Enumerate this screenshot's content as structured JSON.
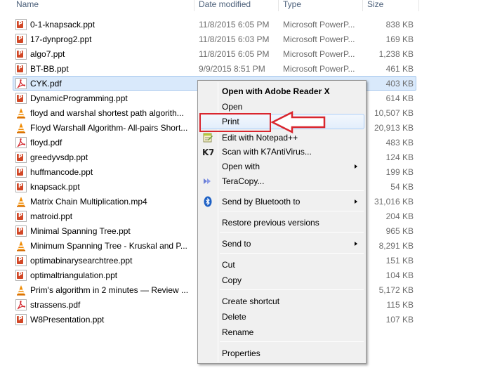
{
  "columns": {
    "name": "Name",
    "date_modified": "Date modified",
    "type": "Type",
    "size": "Size"
  },
  "files": [
    {
      "name": "0-1-knapsack.ppt",
      "date": "11/8/2015 6:05 PM",
      "type": "Microsoft PowerP...",
      "size": "838 KB",
      "icon": "ppt-icon"
    },
    {
      "name": "17-dynprog2.ppt",
      "date": "11/8/2015 6:03 PM",
      "type": "Microsoft PowerP...",
      "size": "169 KB",
      "icon": "ppt-icon"
    },
    {
      "name": "algo7.ppt",
      "date": "11/8/2015 6:05 PM",
      "type": "Microsoft PowerP...",
      "size": "1,238 KB",
      "icon": "ppt-icon"
    },
    {
      "name": "BT-BB.ppt",
      "date": "9/9/2015 8:51 PM",
      "type": "Microsoft PowerP...",
      "size": "461 KB",
      "icon": "ppt-icon"
    },
    {
      "name": "CYK.pdf",
      "date": "",
      "type": "",
      "size": "403 KB",
      "icon": "pdf-icon",
      "selected": true
    },
    {
      "name": "DynamicProgramming.ppt",
      "date": "",
      "type": "",
      "size": "614 KB",
      "icon": "ppt-icon"
    },
    {
      "name": "floyd and warshal shortest path algorith...",
      "date": "",
      "type": "",
      "size": "10,507 KB",
      "icon": "vlc-icon"
    },
    {
      "name": "Floyd Warshall Algorithm- All-pairs Short...",
      "date": "",
      "type": "",
      "size": "20,913 KB",
      "icon": "vlc-icon"
    },
    {
      "name": "floyd.pdf",
      "date": "",
      "type": "",
      "size": "483 KB",
      "icon": "pdf-icon"
    },
    {
      "name": "greedyvsdp.ppt",
      "date": "",
      "type": "",
      "size": "124 KB",
      "icon": "ppt-icon"
    },
    {
      "name": "huffmancode.ppt",
      "date": "",
      "type": "",
      "size": "199 KB",
      "icon": "ppt-icon"
    },
    {
      "name": "knapsack.ppt",
      "date": "",
      "type": "",
      "size": "54 KB",
      "icon": "ppt-icon"
    },
    {
      "name": "Matrix Chain Multiplication.mp4",
      "date": "",
      "type": "",
      "size": "31,016 KB",
      "icon": "vlc-icon"
    },
    {
      "name": "matroid.ppt",
      "date": "",
      "type": "",
      "size": "204 KB",
      "icon": "ppt-icon"
    },
    {
      "name": "Minimal Spanning Tree.ppt",
      "date": "",
      "type": "",
      "size": "965 KB",
      "icon": "ppt-icon"
    },
    {
      "name": "Minimum Spanning Tree - Kruskal and P...",
      "date": "",
      "type": "",
      "size": "8,291 KB",
      "icon": "vlc-icon"
    },
    {
      "name": "optimabinarysearchtree.ppt",
      "date": "",
      "type": "",
      "size": "151 KB",
      "icon": "ppt-icon"
    },
    {
      "name": "optimaltriangulation.ppt",
      "date": "",
      "type": "",
      "size": "104 KB",
      "icon": "ppt-icon"
    },
    {
      "name": "Prim's algorithm in 2 minutes — Review ...",
      "date": "",
      "type": "",
      "size": "5,172 KB",
      "icon": "vlc-icon"
    },
    {
      "name": "strassens.pdf",
      "date": "",
      "type": "",
      "size": "115 KB",
      "icon": "pdf-icon"
    },
    {
      "name": "W8Presentation.ppt",
      "date": "",
      "type": "",
      "size": "107 KB",
      "icon": "ppt-icon"
    }
  ],
  "context_menu": {
    "open_with_reader": "Open with Adobe Reader X",
    "open": "Open",
    "print": "Print",
    "edit_notepad": "Edit with Notepad++",
    "scan_k7": "Scan with K7AntiVirus...",
    "open_with": "Open with",
    "teracopy": "TeraCopy...",
    "send_bluetooth": "Send by Bluetooth to",
    "restore_versions": "Restore previous versions",
    "send_to": "Send to",
    "cut": "Cut",
    "copy": "Copy",
    "create_shortcut": "Create shortcut",
    "delete": "Delete",
    "rename": "Rename",
    "properties": "Properties"
  },
  "colors": {
    "selection_bg": "#d9e9fb",
    "highlight_red": "#d9262e",
    "menu_bg": "#f0f0f0"
  }
}
